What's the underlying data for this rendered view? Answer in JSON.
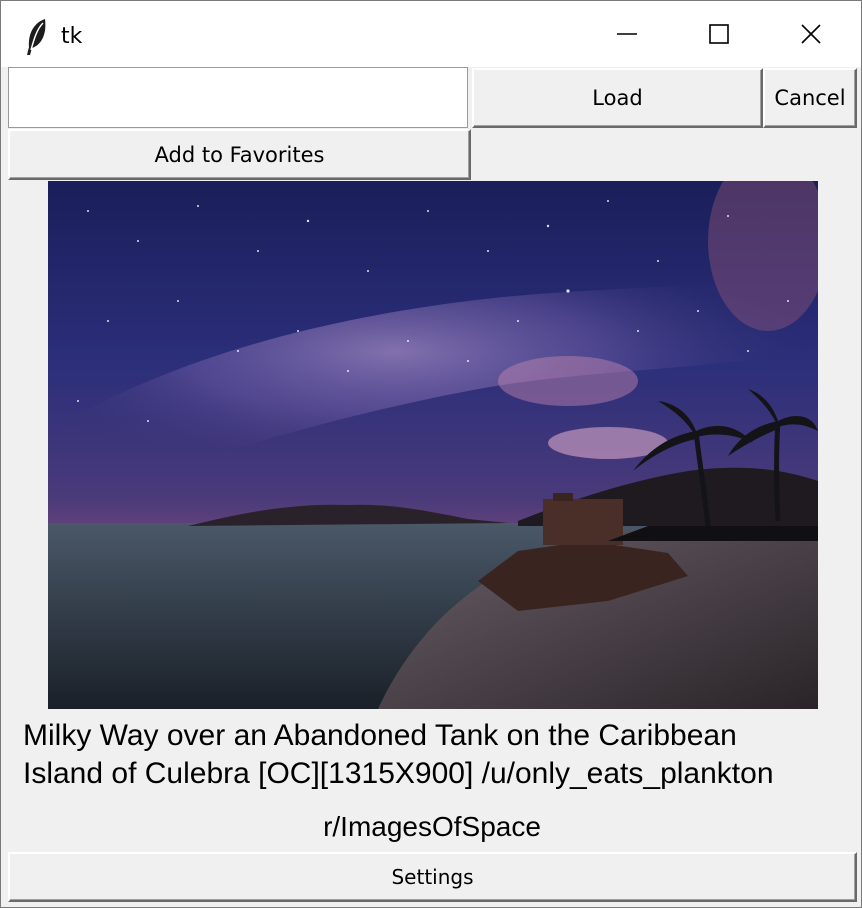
{
  "window": {
    "title": "tk",
    "controls": {
      "minimize_icon": "minimize-icon",
      "maximize_icon": "maximize-icon",
      "close_icon": "close-icon"
    }
  },
  "toolbar": {
    "url_input_value": "",
    "load_label": "Load",
    "cancel_label": "Cancel",
    "favorites_label": "Add to Favorites"
  },
  "post": {
    "image_subject": "Milky Way over a beach with palm trees and an abandoned tank",
    "caption": "Milky Way over an Abandoned Tank on the Caribbean\nIsland of Culebra [OC][1315X900] /u/only_eats_plankton",
    "subreddit": "r/ImagesOfSpace"
  },
  "footer": {
    "settings_label": "Settings"
  }
}
